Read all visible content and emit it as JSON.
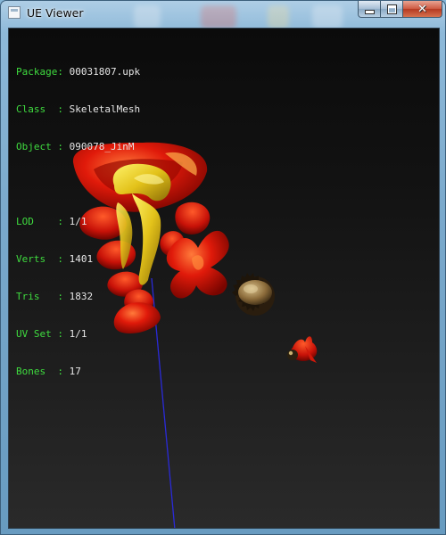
{
  "window": {
    "title": "UE Viewer"
  },
  "info": [
    {
      "key": "Package",
      "sep": ": ",
      "value": "00031807.upk"
    },
    {
      "key": "Class  ",
      "sep": ": ",
      "value": "SkeletalMesh"
    },
    {
      "key": "Object ",
      "sep": ": ",
      "value": "090078_JinM"
    },
    {
      "key": "LOD    ",
      "sep": ": ",
      "value": "1/1"
    },
    {
      "key": "Verts  ",
      "sep": ": ",
      "value": "1401"
    },
    {
      "key": "Tris   ",
      "sep": ": ",
      "value": "1832"
    },
    {
      "key": "UV Set ",
      "sep": ": ",
      "value": "1/1"
    },
    {
      "key": "Bones  ",
      "sep": ": ",
      "value": "17"
    }
  ],
  "colors": {
    "label": "#3fdc3f",
    "value": "#e6e6e6",
    "axis": "#2a2ad8"
  }
}
